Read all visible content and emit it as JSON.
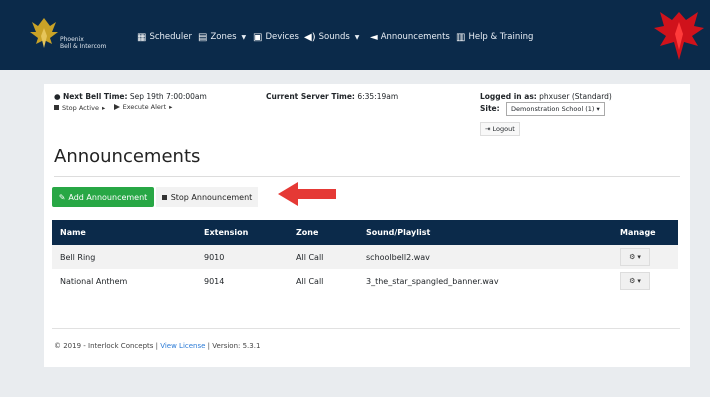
{
  "nav": {
    "brand_line1": "Phoenix",
    "brand_line2": "Bell & Intercom",
    "items": [
      {
        "label": "Scheduler",
        "icon": "calendar-clock-icon"
      },
      {
        "label": "Zones",
        "icon": "building-icon",
        "caret": true
      },
      {
        "label": "Devices",
        "icon": "devices-icon"
      },
      {
        "label": "Sounds",
        "icon": "speaker-icon",
        "caret": true
      },
      {
        "label": "Announcements",
        "icon": "megaphone-icon"
      },
      {
        "label": "Help & Training",
        "icon": "help-icon"
      }
    ]
  },
  "info": {
    "next_bell_label": "Next Bell Time:",
    "next_bell_value": "Sep 19th 7:00:00am",
    "stop_active": "Stop Active",
    "execute_alert": "Execute Alert",
    "server_time_label": "Current Server Time:",
    "server_time_value": "6:35:19am",
    "logged_label": "Logged in as:",
    "logged_value": "phxuser (Standard)",
    "site_label": "Site:",
    "site_value": "Demonstration School (1)",
    "logout": "Logout"
  },
  "page": {
    "title": "Announcements",
    "add_button": "Add Announcement",
    "stop_button": "Stop Announcement"
  },
  "table": {
    "headers": [
      "Name",
      "Extension",
      "Zone",
      "Sound/Playlist",
      "Manage"
    ],
    "rows": [
      [
        "Bell Ring",
        "9010",
        "All Call",
        "schoolbell2.wav"
      ],
      [
        "National Anthem",
        "9014",
        "All Call",
        "3_the_star_spangled_banner.wav"
      ]
    ]
  },
  "footer": {
    "copyright": "© 2019 - Interlock Concepts | ",
    "license_link": "View License",
    "version": " | Version: 5.3.1"
  },
  "colors": {
    "navbar": "#0b2a4a",
    "add_button": "#28a745",
    "arrow": "#e53935"
  }
}
